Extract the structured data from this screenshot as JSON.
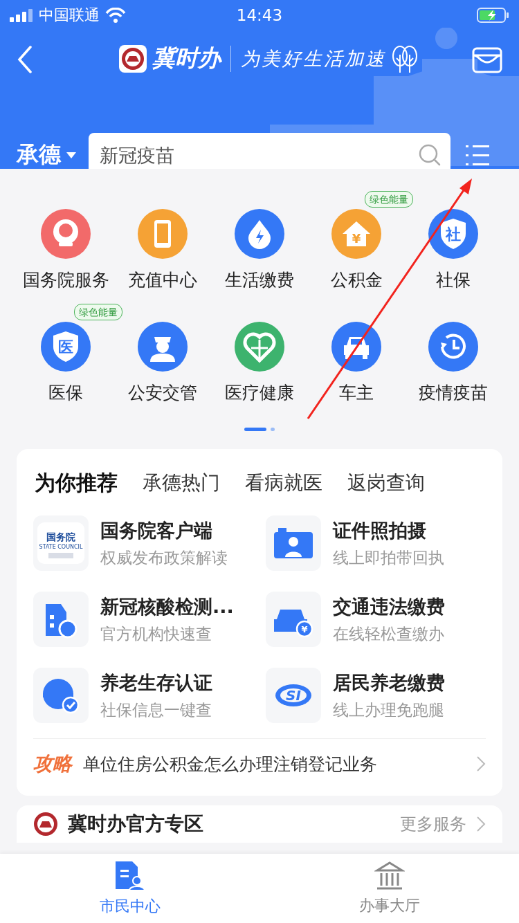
{
  "status_bar": {
    "carrier": "中国联通",
    "time": "14:43"
  },
  "header": {
    "title": "冀时办",
    "slogan": "为美好生活加速",
    "city": "承德",
    "search": {
      "placeholder": "新冠疫苗"
    }
  },
  "services": [
    {
      "label": "国务院服务",
      "kind": "emblem",
      "color": "#f26a6a"
    },
    {
      "label": "充值中心",
      "kind": "phone",
      "color": "#f5a235"
    },
    {
      "label": "生活缴费",
      "kind": "bolt",
      "color": "#3478f6"
    },
    {
      "label": "公积金",
      "kind": "house",
      "color": "#f5a235",
      "badge": "绿色能量",
      "glyph": "¥"
    },
    {
      "label": "社保",
      "kind": "shield",
      "color": "#3478f6",
      "glyph": "社"
    },
    {
      "label": "医保",
      "kind": "shield",
      "color": "#3478f6",
      "badge": "绿色能量",
      "glyph": "医"
    },
    {
      "label": "公安交管",
      "kind": "officer",
      "color": "#3478f6"
    },
    {
      "label": "医疗健康",
      "kind": "heart",
      "color": "#3db36e"
    },
    {
      "label": "车主",
      "kind": "car",
      "color": "#3478f6"
    },
    {
      "label": "疫情疫苗",
      "kind": "clock",
      "color": "#3478f6"
    }
  ],
  "pages": [
    {
      "selected": true
    },
    {
      "selected": false
    }
  ],
  "recommend": {
    "tabs": [
      {
        "label": "为你推荐",
        "selected": true
      },
      {
        "label": "承德热门",
        "selected": false
      },
      {
        "label": "看病就医",
        "selected": false
      },
      {
        "label": "返岗查询",
        "selected": false
      }
    ],
    "items": [
      {
        "title": "国务院客户端",
        "subtitle": "权威发布政策解读",
        "kind": "council",
        "glyphs": [
          "国务院",
          "STATE COUNCIL"
        ]
      },
      {
        "title": "证件照拍摄",
        "subtitle": "线上即拍带回执",
        "kind": "camera"
      },
      {
        "title": "新冠核酸检测...",
        "subtitle": "官方机构快速查",
        "kind": "hospital"
      },
      {
        "title": "交通违法缴费",
        "subtitle": "在线轻松查缴办",
        "kind": "car-yen",
        "glyphs": [
          "¥"
        ]
      },
      {
        "title": "养老生存认证",
        "subtitle": "社保信息一键查",
        "kind": "person-check"
      },
      {
        "title": "居民养老缴费",
        "subtitle": "线上办理免跑腿",
        "kind": "si",
        "glyphs": [
          "SI"
        ]
      }
    ],
    "tip": {
      "tag": "攻略",
      "text": "单位住房公积金怎么办理注销登记业务"
    }
  },
  "zone": {
    "title": "冀时办官方专区",
    "more": "更多服务"
  },
  "tab_bar": [
    {
      "label": "市民中心",
      "selected": true
    },
    {
      "label": "办事大厅",
      "selected": false
    }
  ]
}
